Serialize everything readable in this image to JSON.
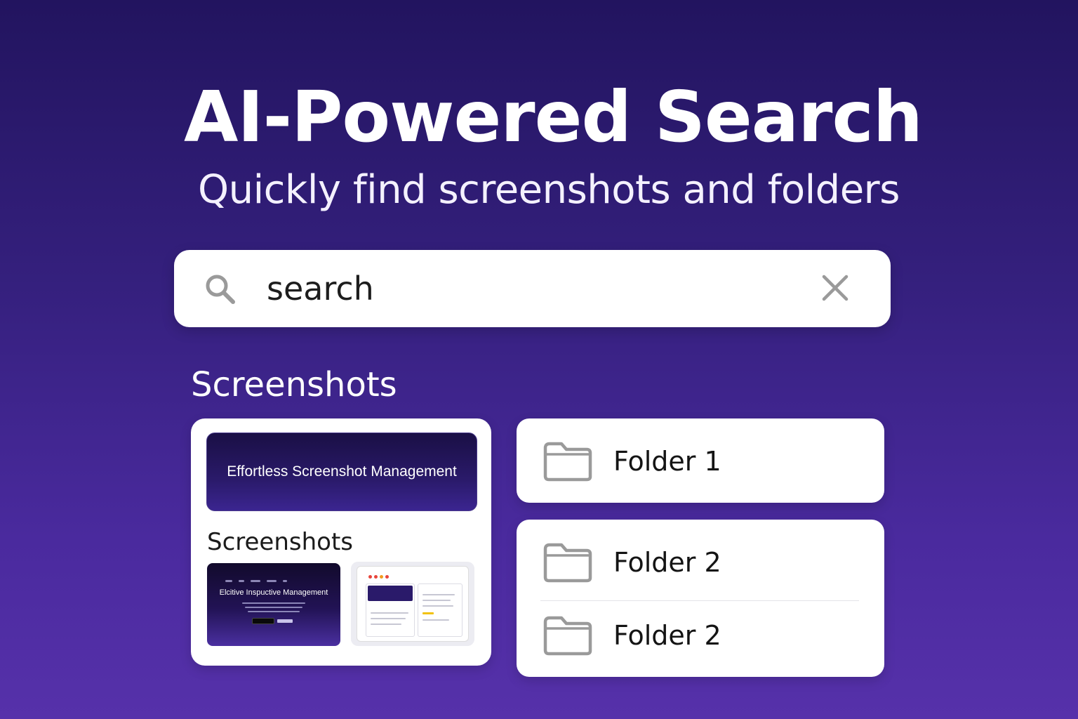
{
  "header": {
    "title": "AI-Powered Search",
    "subtitle": "Quickly find screenshots and folders"
  },
  "search": {
    "value": "search",
    "search_icon": "search-icon",
    "clear_icon": "close-icon"
  },
  "screenshots_section": {
    "title": "Screenshots",
    "banner_text": "Effortless Screenshot Management",
    "card_subtitle": "Screenshots",
    "thumbnail_1_title": "Elcitive Inspuctive Management"
  },
  "folders": [
    {
      "label": "Folder 1",
      "icon": "folder-icon"
    },
    {
      "label": "Folder 2",
      "icon": "folder-icon"
    },
    {
      "label": "Folder 2",
      "icon": "folder-icon"
    }
  ],
  "colors": {
    "background_top": "#22145f",
    "background_bottom": "#5631aa",
    "card": "#ffffff",
    "icon_gray": "#9a9a9a"
  }
}
